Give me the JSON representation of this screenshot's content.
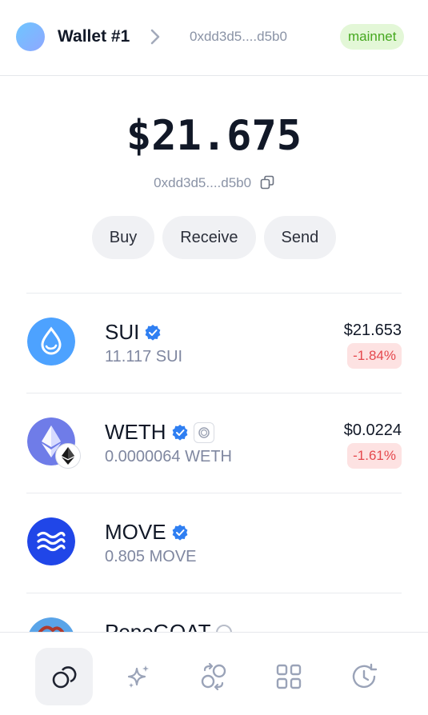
{
  "header": {
    "wallet_name": "Wallet #1",
    "address": "0xdd3d5....d5b0",
    "network": "mainnet"
  },
  "balance": {
    "amount": "$21.675",
    "address": "0xdd3d5....d5b0"
  },
  "actions": {
    "buy": "Buy",
    "receive": "Receive",
    "send": "Send"
  },
  "tokens": [
    {
      "name": "SUI",
      "amount": "11.117 SUI",
      "value": "$21.653",
      "change": "-1.84%",
      "icon": "sui-icon",
      "color": "#4da2ff"
    },
    {
      "name": "WETH",
      "amount": "0.0000064 WETH",
      "value": "$0.0224",
      "change": "-1.61%",
      "icon": "ethereum-icon",
      "color": "#6f7ce8"
    },
    {
      "name": "MOVE",
      "amount": "0.805 MOVE",
      "value": "",
      "change": "",
      "icon": "move-icon",
      "color": "#2046e8"
    },
    {
      "name": "PepeGOAT",
      "amount": "",
      "value": "",
      "change": "",
      "icon": "pepegoat-icon",
      "color": "#5aa4e8"
    }
  ],
  "nav": [
    "coins-icon",
    "sparkles-icon",
    "swap-icon",
    "apps-grid-icon",
    "history-clock-icon"
  ],
  "colors": {
    "accent": "#4da2ff",
    "negative": "#e5484d",
    "negative_bg": "#fde2e2",
    "network_bg": "#e3f7d7",
    "network_text": "#46a81f",
    "verified": "#2f7ff2"
  }
}
